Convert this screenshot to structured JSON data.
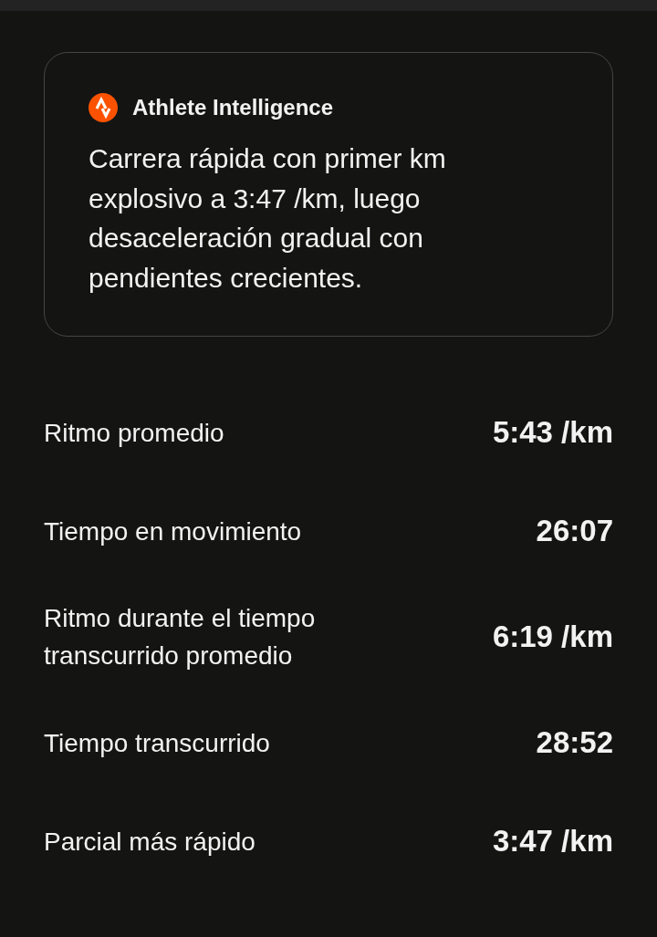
{
  "insight_card": {
    "title": "Athlete Intelligence",
    "summary": "Carrera rápida con primer km explosivo a 3:47 /km, luego desaceleración gradual con pendientes crecientes."
  },
  "stats": [
    {
      "label": "Ritmo promedio",
      "value": "5:43 /km"
    },
    {
      "label": "Tiempo en movimiento",
      "value": "26:07"
    },
    {
      "label": "Ritmo durante el tiempo transcurrido promedio",
      "value": "6:19 /km"
    },
    {
      "label": "Tiempo transcurrido",
      "value": "28:52"
    },
    {
      "label": "Parcial más rápido",
      "value": "3:47 /km"
    }
  ]
}
